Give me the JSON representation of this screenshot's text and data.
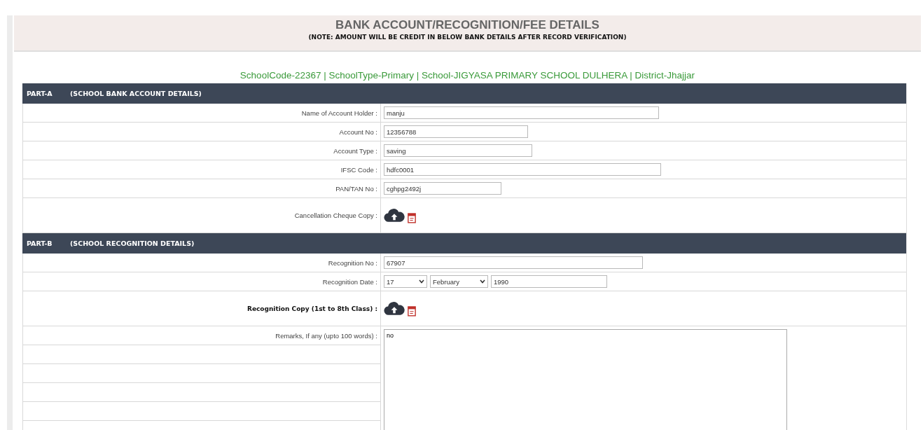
{
  "header": {
    "title": "BANK ACCOUNT/RECOGNITION/FEE DETAILS",
    "note": "(NOTE: AMOUNT WILL BE CREDIT IN BELOW BANK DETAILS AFTER RECORD VERIFICATION)"
  },
  "info_line": "SchoolCode-22367 | SchoolType-Primary | School-JIGYASA PRIMARY SCHOOL DULHERA | District-Jhajjar",
  "sections": [
    {
      "part": "PART-A",
      "title": "(SCHOOL BANK ACCOUNT DETAILS)",
      "rows": [
        {
          "kind": "text",
          "label": "Name of Account Holder :",
          "bold": false,
          "value": "manju"
        },
        {
          "kind": "text",
          "label": "Account No :",
          "bold": false,
          "value": "12356788"
        },
        {
          "kind": "text",
          "label": "Account Type :",
          "bold": false,
          "value": "saving"
        },
        {
          "kind": "text",
          "label": "IFSC Code :",
          "bold": false,
          "value": "hdfc0001"
        },
        {
          "kind": "text",
          "label": "PAN/TAN No :",
          "bold": false,
          "value": "cghpg2492j"
        },
        {
          "kind": "file",
          "label": "Cancellation Cheque Copy :",
          "bold": false
        }
      ]
    },
    {
      "part": "PART-B",
      "title": "(SCHOOL RECOGNITION DETAILS)",
      "rows": [
        {
          "kind": "text",
          "label": "Recognition No :",
          "bold": false,
          "value": "67907"
        },
        {
          "kind": "date",
          "label": "Recognition Date :",
          "bold": false,
          "day": "17",
          "month": "February",
          "year": "1990"
        },
        {
          "kind": "file",
          "label": "Recognition Copy (1st to 8th Class) :",
          "bold": true
        },
        {
          "kind": "textarea",
          "label": "Remarks, If any (upto 100 words) :",
          "bold": false,
          "value": "no"
        }
      ]
    }
  ]
}
